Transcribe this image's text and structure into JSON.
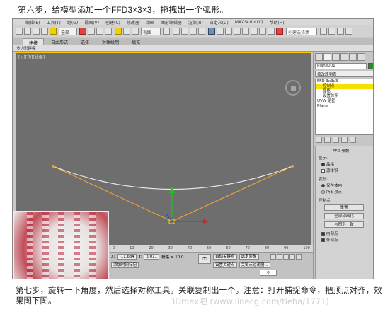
{
  "caption_top": "第六步，给模型添加一个FFD3×3×3，拖拽出一个弧形。",
  "caption_bottom": "第七步，旋转一下角度，然后选择对称工具。关联复制出一个。注意：打开捕捉命令，把顶点对齐，效果图下图。",
  "watermark": "3Dmax吧 (www.linecg.com/tieba/1771)",
  "menubar": [
    "编辑(E)",
    "工具(T)",
    "组(G)",
    "视图(V)",
    "创建(C)",
    "修改器",
    "动画",
    "图形编辑器",
    "渲染(R)",
    "自定义(U)",
    "MAXScript(X)",
    "帮助(H)"
  ],
  "toolbar": {
    "select_filter": "全部",
    "view_select": "视图",
    "search_placeholder": "创建选择集"
  },
  "ribbon": {
    "tabs": [
      "建模",
      "自由形式",
      "选择",
      "对象绘制",
      "填充"
    ],
    "active_tab": "建模",
    "sub_label": "多边形建模"
  },
  "viewport": {
    "label": "[+][顶][线框]",
    "border_color": "#f6c800",
    "lattice_color": "#f0a030",
    "curve_color": "#e8e8e8"
  },
  "panel": {
    "object_name": "Plane001",
    "modifier_list": "修改器列表",
    "stack": [
      "FFD 3x3x3",
      "控制点",
      "晶格",
      "设置体积",
      "UVW 贴图",
      "Plane"
    ],
    "stack_selected": 1,
    "rollout_title": "FFD 参数",
    "display_group": "显示:",
    "display_lattice": "晶格",
    "display_source": "源体积",
    "deform_group": "变形:",
    "deform_inside": "仅在体内",
    "deform_all": "所有顶点",
    "control_group": "控制点:",
    "btn_reset": "重置",
    "btn_animate_all": "全部动画化",
    "btn_conform": "与图形一致",
    "inside_points": "内部点",
    "outside_points": "外部点"
  },
  "bottom": {
    "ruler_ticks": [
      "0",
      "10",
      "20",
      "30",
      "40",
      "50",
      "60",
      "70",
      "80",
      "90",
      "100"
    ],
    "x_label": "X:",
    "x_value": "-11.684",
    "y_label": "Y:",
    "y_value": "3.011",
    "grid_label": "栅格 = 10.0",
    "auto_key": "自动关键点",
    "set_key": "设置关键点",
    "selected": "选定对象",
    "key_filters": "关键点过滤器...",
    "add_time_tag": "添加时间标记",
    "frame": "0"
  },
  "thumbnail_desc_colors": {
    "pattern": "#b8243a",
    "base": "#f4f4f4"
  }
}
